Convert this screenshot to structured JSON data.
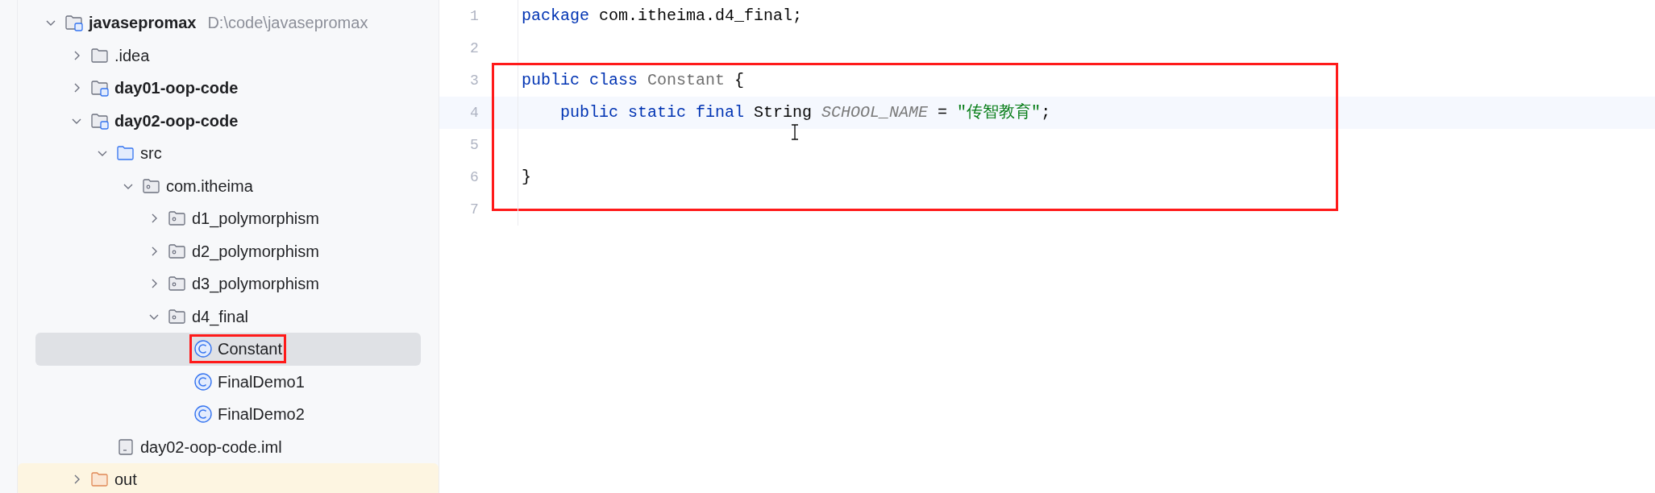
{
  "project_tree": [
    {
      "label": "javasepromax",
      "detail": "D:\\code\\javasepromax",
      "kind": "module",
      "bold": true,
      "expanded": true,
      "children": [
        {
          "label": ".idea",
          "kind": "folder",
          "expanded": false
        },
        {
          "label": "day01-oop-code",
          "kind": "module",
          "bold": true,
          "expanded": false
        },
        {
          "label": "day02-oop-code",
          "kind": "module",
          "bold": true,
          "expanded": true,
          "children": [
            {
              "label": "src",
              "kind": "source",
              "expanded": true,
              "children": [
                {
                  "label": "com.itheima",
                  "kind": "package",
                  "expanded": true,
                  "children": [
                    {
                      "label": "d1_polymorphism",
                      "kind": "package",
                      "expanded": false
                    },
                    {
                      "label": "d2_polymorphism",
                      "kind": "package",
                      "expanded": false
                    },
                    {
                      "label": "d3_polymorphism",
                      "kind": "package",
                      "expanded": false
                    },
                    {
                      "label": "d4_final",
                      "kind": "package",
                      "expanded": true,
                      "children": [
                        {
                          "label": "Constant",
                          "kind": "class",
                          "selected": true,
                          "highlighted": true
                        },
                        {
                          "label": "FinalDemo1",
                          "kind": "class",
                          "selected": false,
                          "highlighted": false
                        },
                        {
                          "label": "FinalDemo2",
                          "kind": "class",
                          "selected": false,
                          "highlighted": false
                        }
                      ]
                    }
                  ]
                }
              ]
            },
            {
              "label": "day02-oop-code.iml",
              "kind": "file"
            }
          ]
        },
        {
          "label": "out",
          "kind": "excluded",
          "expanded": false,
          "excluded": true
        }
      ]
    }
  ],
  "editor": {
    "lines": [
      {
        "number": "1",
        "current": false,
        "highlighted": false,
        "tokens": [
          {
            "kind": "keyword",
            "text": "package"
          },
          {
            "kind": "plain",
            "text": " com.itheima.d4_final;"
          }
        ]
      },
      {
        "number": "2",
        "current": false,
        "highlighted": false
      },
      {
        "number": "3",
        "current": false,
        "highlighted": true,
        "tokens": [
          {
            "kind": "keyword",
            "text": "public class"
          },
          {
            "kind": "unused",
            "text": " Constant"
          },
          {
            "kind": "plain",
            "text": " {"
          }
        ]
      },
      {
        "number": "4",
        "current": true,
        "highlighted": true,
        "tokens": [
          {
            "kind": "keyword",
            "text": "    public static final"
          },
          {
            "kind": "plain",
            "text": " String "
          },
          {
            "kind": "constant",
            "text": "SCHOOL_NAME"
          },
          {
            "kind": "plain",
            "text": " = "
          },
          {
            "kind": "string",
            "text": "\"传智教育\""
          },
          {
            "kind": "plain",
            "text": ";"
          }
        ]
      },
      {
        "number": "5",
        "current": false,
        "highlighted": true
      },
      {
        "number": "6",
        "current": false,
        "highlighted": true,
        "tokens": [
          {
            "kind": "plain",
            "text": "}"
          }
        ]
      },
      {
        "number": "7",
        "current": false,
        "highlighted": false
      }
    ]
  }
}
